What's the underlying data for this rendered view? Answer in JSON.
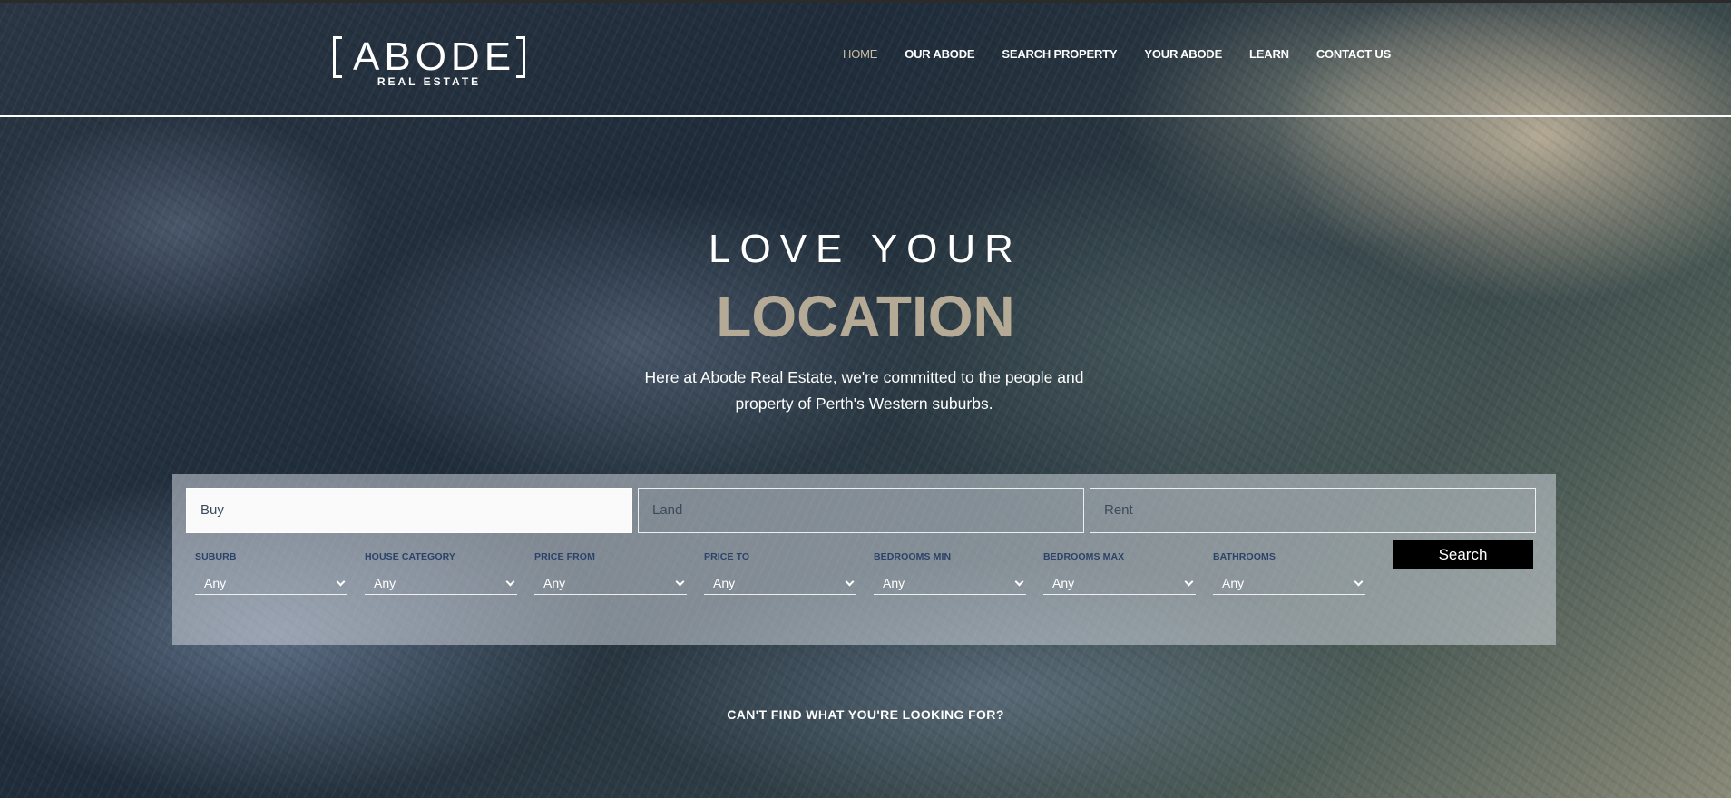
{
  "brand": {
    "name": "ABODE",
    "tagline": "REAL ESTATE"
  },
  "nav": {
    "items": [
      {
        "label": "HOME",
        "active": true
      },
      {
        "label": "OUR ABODE"
      },
      {
        "label": "SEARCH PROPERTY"
      },
      {
        "label": "YOUR ABODE"
      },
      {
        "label": "LEARN"
      },
      {
        "label": "CONTACT US"
      }
    ]
  },
  "hero": {
    "line1": "LOVE YOUR",
    "line2": "LOCATION",
    "description": "Here at Abode Real Estate, we're committed to the people and property of Perth's Western suburbs."
  },
  "search": {
    "tabs": [
      {
        "label": "Buy",
        "active": true
      },
      {
        "label": "Land"
      },
      {
        "label": "Rent"
      }
    ],
    "filters": [
      {
        "label": "SUBURB",
        "value": "Any"
      },
      {
        "label": "HOUSE CATEGORY",
        "value": "Any"
      },
      {
        "label": "PRICE FROM",
        "value": "Any"
      },
      {
        "label": "PRICE TO",
        "value": "Any"
      },
      {
        "label": "BEDROOMS MIN",
        "value": "Any"
      },
      {
        "label": "BEDROOMS MAX",
        "value": "Any"
      },
      {
        "label": "BATHROOMS",
        "value": "Any"
      }
    ],
    "button_label": "Search"
  },
  "footer_prompt": "CAN'T FIND WHAT YOU'RE LOOKING FOR?",
  "colors": {
    "accent": "#b5aa95",
    "nav_active": "#c9bfa7",
    "filter_label": "#2c4268"
  }
}
